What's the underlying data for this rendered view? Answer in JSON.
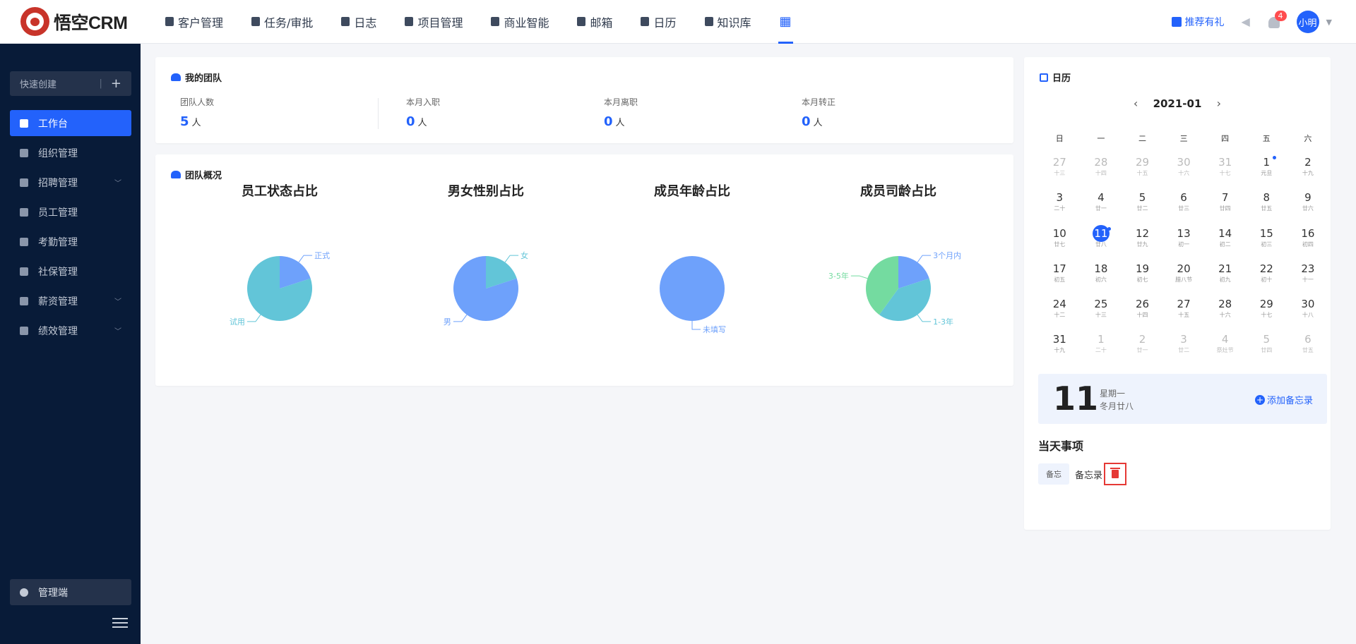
{
  "app": {
    "logo_text": "悟空CRM"
  },
  "nav": {
    "items": [
      {
        "label": "客户管理",
        "icon": "building-icon"
      },
      {
        "label": "任务/审批",
        "icon": "briefcase-icon"
      },
      {
        "label": "日志",
        "icon": "document-icon"
      },
      {
        "label": "项目管理",
        "icon": "kanban-icon"
      },
      {
        "label": "商业智能",
        "icon": "chart-shield-icon"
      },
      {
        "label": "邮箱",
        "icon": "mail-icon"
      },
      {
        "label": "日历",
        "icon": "calendar-icon"
      },
      {
        "label": "知识库",
        "icon": "book-icon"
      }
    ],
    "apps_icon": "grid-icon"
  },
  "header": {
    "gift_label": "推荐有礼",
    "notification_count": "4",
    "user_name": "小明"
  },
  "sidebar": {
    "quick_create": "快速创建",
    "quick_sep": "|",
    "quick_plus": "+",
    "items": [
      {
        "label": "工作台",
        "active": true,
        "expandable": false
      },
      {
        "label": "组织管理",
        "active": false,
        "expandable": false
      },
      {
        "label": "招聘管理",
        "active": false,
        "expandable": true
      },
      {
        "label": "员工管理",
        "active": false,
        "expandable": false
      },
      {
        "label": "考勤管理",
        "active": false,
        "expandable": false
      },
      {
        "label": "社保管理",
        "active": false,
        "expandable": false
      },
      {
        "label": "薪资管理",
        "active": false,
        "expandable": true
      },
      {
        "label": "绩效管理",
        "active": false,
        "expandable": true
      }
    ],
    "admin_label": "管理端"
  },
  "team": {
    "title": "我的团队",
    "stats": [
      {
        "label": "团队人数",
        "value": "5",
        "unit": "人"
      },
      {
        "label": "本月入职",
        "value": "0",
        "unit": "人"
      },
      {
        "label": "本月离职",
        "value": "0",
        "unit": "人"
      },
      {
        "label": "本月转正",
        "value": "0",
        "unit": "人"
      }
    ]
  },
  "overview": {
    "title": "团队概况"
  },
  "chart_data": [
    {
      "type": "pie",
      "title": "员工状态占比",
      "categories": [
        "正式",
        "试用"
      ],
      "values": [
        1,
        4
      ],
      "colors": [
        "#6ea1fb",
        "#62c5d8"
      ]
    },
    {
      "type": "pie",
      "title": "男女性别占比",
      "categories": [
        "女",
        "男"
      ],
      "values": [
        1,
        4
      ],
      "colors": [
        "#62c5d8",
        "#6ea1fb"
      ]
    },
    {
      "type": "pie",
      "title": "成员年龄占比",
      "categories": [
        "未填写"
      ],
      "values": [
        5
      ],
      "colors": [
        "#6ea1fb"
      ]
    },
    {
      "type": "pie",
      "title": "成员司龄占比",
      "categories": [
        "3个月内",
        "1-3年",
        "3-5年"
      ],
      "values": [
        1,
        2,
        2
      ],
      "colors": [
        "#6ea1fb",
        "#62c5d8",
        "#74dba0"
      ]
    }
  ],
  "calendar": {
    "title": "日历",
    "month": "2021-01",
    "prev": "‹",
    "next": "›",
    "weekdays": [
      "日",
      "一",
      "二",
      "三",
      "四",
      "五",
      "六"
    ],
    "days": [
      {
        "d": "27",
        "l": "十三",
        "other": true
      },
      {
        "d": "28",
        "l": "十四",
        "other": true
      },
      {
        "d": "29",
        "l": "十五",
        "other": true
      },
      {
        "d": "30",
        "l": "十六",
        "other": true
      },
      {
        "d": "31",
        "l": "十七",
        "other": true
      },
      {
        "d": "1",
        "l": "元旦",
        "dot": true
      },
      {
        "d": "2",
        "l": "十九"
      },
      {
        "d": "3",
        "l": "二十"
      },
      {
        "d": "4",
        "l": "廿一"
      },
      {
        "d": "5",
        "l": "廿二"
      },
      {
        "d": "6",
        "l": "廿三"
      },
      {
        "d": "7",
        "l": "廿四"
      },
      {
        "d": "8",
        "l": "廿五"
      },
      {
        "d": "9",
        "l": "廿六"
      },
      {
        "d": "10",
        "l": "廿七"
      },
      {
        "d": "11",
        "l": "廿八",
        "today": true,
        "dot": true
      },
      {
        "d": "12",
        "l": "廿九"
      },
      {
        "d": "13",
        "l": "初一"
      },
      {
        "d": "14",
        "l": "初二"
      },
      {
        "d": "15",
        "l": "初三"
      },
      {
        "d": "16",
        "l": "初四"
      },
      {
        "d": "17",
        "l": "初五"
      },
      {
        "d": "18",
        "l": "初六"
      },
      {
        "d": "19",
        "l": "初七"
      },
      {
        "d": "20",
        "l": "腊八节"
      },
      {
        "d": "21",
        "l": "初九"
      },
      {
        "d": "22",
        "l": "初十"
      },
      {
        "d": "23",
        "l": "十一"
      },
      {
        "d": "24",
        "l": "十二"
      },
      {
        "d": "25",
        "l": "十三"
      },
      {
        "d": "26",
        "l": "十四"
      },
      {
        "d": "27",
        "l": "十五"
      },
      {
        "d": "28",
        "l": "十六"
      },
      {
        "d": "29",
        "l": "十七"
      },
      {
        "d": "30",
        "l": "十八"
      },
      {
        "d": "31",
        "l": "十九"
      },
      {
        "d": "1",
        "l": "二十",
        "other": true
      },
      {
        "d": "2",
        "l": "廿一",
        "other": true
      },
      {
        "d": "3",
        "l": "廿二",
        "other": true
      },
      {
        "d": "4",
        "l": "祭灶节",
        "other": true
      },
      {
        "d": "5",
        "l": "廿四",
        "other": true
      },
      {
        "d": "6",
        "l": "廿五",
        "other": true
      }
    ],
    "today_number": "11",
    "today_weekday": "星期一",
    "today_lunar": "冬月廿八",
    "add_memo": "添加备忘录",
    "events_title": "当天事项",
    "events": [
      {
        "tag": "备忘",
        "text": "备忘录"
      }
    ]
  }
}
